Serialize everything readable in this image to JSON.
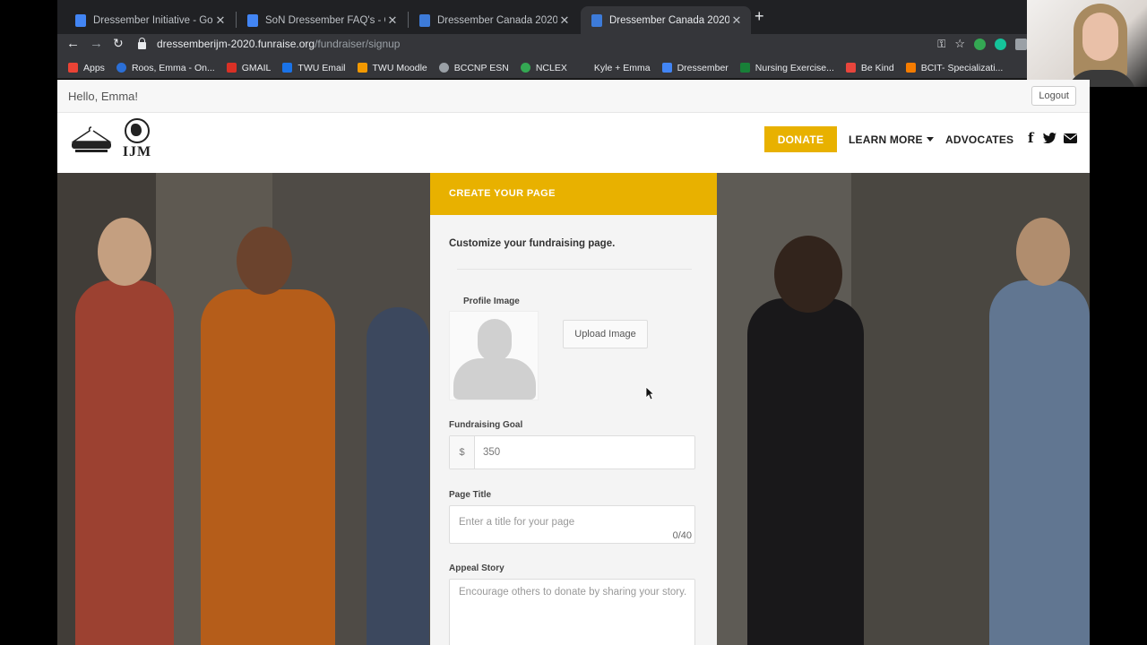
{
  "browser": {
    "tabs": [
      {
        "title": "Dressember Initiative - Google",
        "icon_color": "#4285f4",
        "active": false
      },
      {
        "title": "SoN Dressember FAQ's - Goog",
        "icon_color": "#4285f4",
        "active": false
      },
      {
        "title": "Dressember Canada 2020",
        "icon_color": "#3d7bd9",
        "active": false
      },
      {
        "title": "Dressember Canada 2020",
        "icon_color": "#3d7bd9",
        "active": true
      }
    ],
    "url_host": "dressemberijm-2020.funraise.org",
    "url_path": "/fundraiser/signup",
    "bookmarks": [
      {
        "label": "Apps",
        "color": "#ea4335"
      },
      {
        "label": "Roos, Emma - On...",
        "color": "#2b6fd6"
      },
      {
        "label": "GMAIL",
        "color": "#d93025"
      },
      {
        "label": "TWU Email",
        "color": "#1a73e8"
      },
      {
        "label": "TWU Moodle",
        "color": "#f29900"
      },
      {
        "label": "BCCNP ESN",
        "color": "#9aa0a6"
      },
      {
        "label": "NCLEX",
        "color": "#34a853"
      },
      {
        "label": "Kyle + Emma",
        "color": "#35363a"
      },
      {
        "label": "Dressember",
        "color": "#4285f4"
      },
      {
        "label": "Nursing Exercise...",
        "color": "#188038"
      },
      {
        "label": "Be Kind",
        "color": "#e8453c"
      },
      {
        "label": "BCIT- Specializati...",
        "color": "#f57c00"
      }
    ]
  },
  "site": {
    "greeting": "Hello, Emma!",
    "logout_label": "Logout",
    "logo_text": "IJM",
    "nav": {
      "donate": "DONATE",
      "learn_more": "LEARN MORE",
      "advocates": "ADVOCATES"
    },
    "social_icons": [
      "facebook-icon",
      "twitter-icon",
      "envelope-icon"
    ],
    "accent_color": "#e8b100"
  },
  "form": {
    "header": "CREATE YOUR PAGE",
    "subtitle": "Customize your fundraising page.",
    "profile_image_label": "Profile Image",
    "upload_label": "Upload Image",
    "goal_label": "Fundraising Goal",
    "goal_prefix": "$",
    "goal_value": "350",
    "page_title_label": "Page Title",
    "page_title_placeholder": "Enter a title for your page",
    "page_title_counter": "0/40",
    "appeal_label": "Appeal Story",
    "appeal_placeholder": "Encourage others to donate by sharing your story."
  }
}
